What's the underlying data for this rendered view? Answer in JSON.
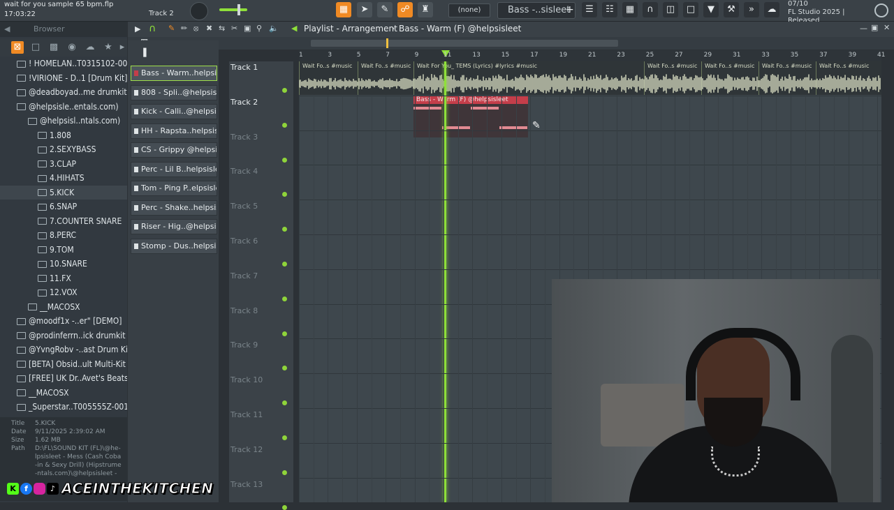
{
  "hint_bar": {
    "text": "wait for you sample 65 bpm.flp",
    "time": "17:03:22",
    "track": "Track 2"
  },
  "toolbar": {
    "none_label": "(none)",
    "pattern_label": "Bass -..sisleet",
    "plus": "+"
  },
  "fl_info": {
    "date": "07/10",
    "product": "FL Studio 2025 |",
    "status": "Released"
  },
  "browser": {
    "title": "Browser",
    "items": [
      {
        "label": "! HOMELAN..T0315102-001",
        "depth": 0
      },
      {
        "label": "!VIRIONE - D..1 [Drum Kit]",
        "depth": 0
      },
      {
        "label": "@deadboyad..me drumkit",
        "depth": 0
      },
      {
        "label": "@helpsisle..entals.com)",
        "depth": 0
      },
      {
        "label": "@helpsisl..ntals.com)",
        "depth": 1
      },
      {
        "label": "1.808",
        "depth": 2
      },
      {
        "label": "2.SEXYBASS",
        "depth": 2
      },
      {
        "label": "3.CLAP",
        "depth": 2
      },
      {
        "label": "4.HIHATS",
        "depth": 2
      },
      {
        "label": "5.KICK",
        "depth": 2
      },
      {
        "label": "6.SNAP",
        "depth": 2
      },
      {
        "label": "7.COUNTER SNARE",
        "depth": 2
      },
      {
        "label": "8.PERC",
        "depth": 2
      },
      {
        "label": "9.TOM",
        "depth": 2
      },
      {
        "label": "10.SNARE",
        "depth": 2
      },
      {
        "label": "11.FX",
        "depth": 2
      },
      {
        "label": "12.VOX",
        "depth": 2
      },
      {
        "label": "__MACOSX",
        "depth": 1
      },
      {
        "label": "@moodf1x -..er\" [DEMO]",
        "depth": 0
      },
      {
        "label": "@prodinferrn..ick drumkit",
        "depth": 0
      },
      {
        "label": "@YvngRobv -..ast Drum Kit",
        "depth": 0
      },
      {
        "label": "[BETA] Obsid..ult Multi-Kit",
        "depth": 0
      },
      {
        "label": "[FREE] UK Dr..Avet's Beats",
        "depth": 0
      },
      {
        "label": "__MACOSX",
        "depth": 0
      },
      {
        "label": "_Superstar..T005555Z-001",
        "depth": 0
      }
    ],
    "info": {
      "title_key": "Title",
      "title_val": "5.KICK",
      "date_key": "Date",
      "date_val": "9/11/2025 2:39:02 AM",
      "size_key": "Size",
      "size_val": "1.62 MB",
      "path_key": "Path",
      "path_val": "D:\\FL\\SOUND KIT (FL)\\@he-lpsisleet - Mess (Cash Coba-in & Sexy Drill) (Hipstrume-ntals.com)\\@helpsisleet -"
    }
  },
  "channels": [
    "Bass - Warm..helpsisleet",
    "808 - Spli..@helpsisleet",
    "Kick - Calli..@helpsisleet",
    "HH - Rapsta..helpsisleet",
    "CS - Grippy @helpsisleet",
    "Perc - Lil B..helpsisleet",
    "Tom - Ping P..elpsisleet",
    "Perc - Shake..helpsisleet",
    "Riser - Hig..@helpsisleet",
    "Stomp - Dus..helpsisleet"
  ],
  "playlist": {
    "title": "Playlist - Arrangement",
    "pattern": "Bass - Warm (F) @helpsisleet",
    "bar_numbers": [
      "1",
      "3",
      "5",
      "7",
      "9",
      "11",
      "13",
      "15",
      "17",
      "19",
      "21",
      "23",
      "25",
      "27",
      "29",
      "31",
      "33",
      "35",
      "37",
      "39",
      "41"
    ],
    "tracks": [
      "Track 1",
      "Track 2",
      "Track 3",
      "Track 4",
      "Track 5",
      "Track 6",
      "Track 7",
      "Track 8",
      "Track 9",
      "Track 10",
      "Track 11",
      "Track 12",
      "Track 13"
    ],
    "audio_clips": [
      "Wait Fo..s #music",
      "Wait Fo..s #music",
      "Wait For You_ TEMS (Lyrics) #lyrics #music",
      "Wait Fo..s #music",
      "Wait Fo..s #music",
      "Wait Fo..s #music",
      "Wait Fo..s #music"
    ],
    "pattern_clip": "Bass - Warm (F) @helpsisleet"
  },
  "overlay": {
    "brand": "ACEINTHEKITCHEN"
  },
  "colors": {
    "accent": "#f08a24",
    "playhead": "#8fe03a",
    "clip_red": "#c43e4a",
    "waveform": "#cdd2b8"
  }
}
